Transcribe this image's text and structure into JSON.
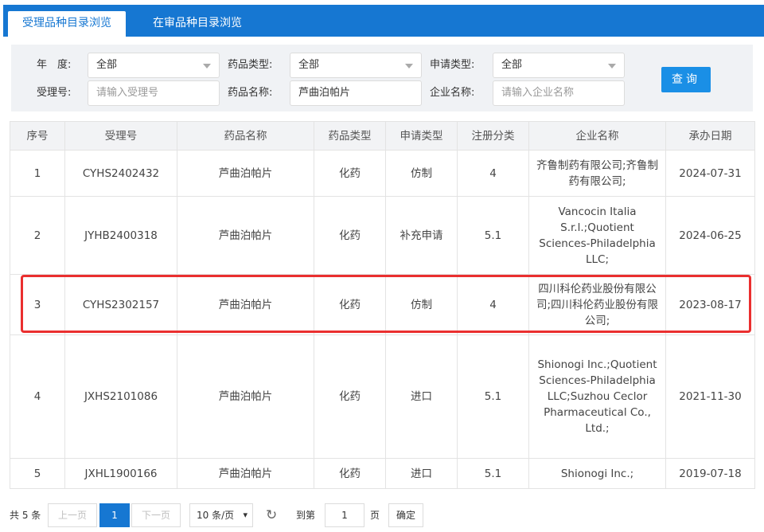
{
  "tabs": [
    {
      "label": "受理品种目录浏览",
      "active": true
    },
    {
      "label": "在审品种目录浏览",
      "active": false
    }
  ],
  "filters": {
    "year": {
      "label": "年　度:",
      "value": "全部"
    },
    "drug_type": {
      "label": "药品类型:",
      "value": "全部"
    },
    "apply_type": {
      "label": "申请类型:",
      "value": "全部"
    },
    "accept_no": {
      "label": "受理号:",
      "placeholder": "请输入受理号"
    },
    "drug_name": {
      "label": "药品名称:",
      "value": "芦曲泊帕片"
    },
    "company": {
      "label": "企业名称:",
      "placeholder": "请输入企业名称"
    },
    "query_label": "查询"
  },
  "table": {
    "headers": [
      "序号",
      "受理号",
      "药品名称",
      "药品类型",
      "申请类型",
      "注册分类",
      "企业名称",
      "承办日期"
    ],
    "rows": [
      [
        "1",
        "CYHS2402432",
        "芦曲泊帕片",
        "化药",
        "仿制",
        "4",
        "齐鲁制药有限公司;齐鲁制药有限公司;",
        "2024-07-31"
      ],
      [
        "2",
        "JYHB2400318",
        "芦曲泊帕片",
        "化药",
        "补充申请",
        "5.1",
        "Vancocin Italia S.r.l.;Quotient Sciences-Philadelphia LLC;",
        "2024-06-25"
      ],
      [
        "3",
        "CYHS2302157",
        "芦曲泊帕片",
        "化药",
        "仿制",
        "4",
        "四川科伦药业股份有限公司;四川科伦药业股份有限公司;",
        "2023-08-17"
      ],
      [
        "4",
        "JXHS2101086",
        "芦曲泊帕片",
        "化药",
        "进口",
        "5.1",
        "Shionogi Inc.;Quotient Sciences-Philadelphia LLC;Suzhou Ceclor Pharmaceutical Co., Ltd.;",
        "2021-11-30"
      ],
      [
        "5",
        "JXHL1900166",
        "芦曲泊帕片",
        "化药",
        "进口",
        "5.1",
        "Shionogi Inc.;",
        "2019-07-18"
      ]
    ],
    "highlighted_row": 3
  },
  "pager": {
    "total": "共 5 条",
    "prev": "上一页",
    "current": "1",
    "next": "下一页",
    "page_size": "10 条/页",
    "goto_prefix": "到第",
    "goto_value": "1",
    "goto_suffix": "页",
    "confirm": "确定"
  },
  "colors": {
    "accent": "#1677d2",
    "highlight": "#ea2f2f"
  }
}
